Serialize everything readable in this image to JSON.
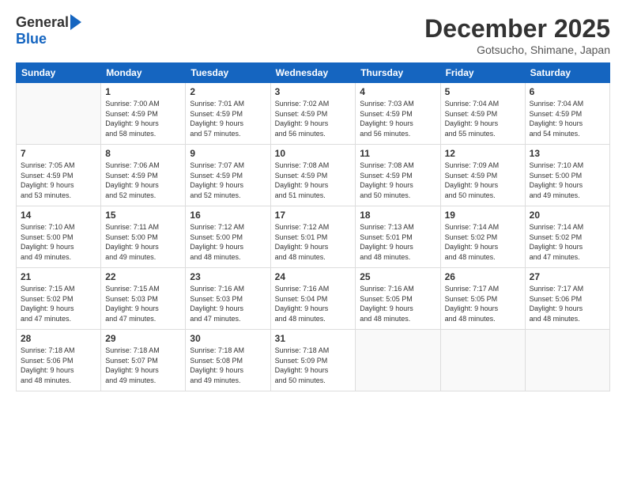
{
  "logo": {
    "general": "General",
    "blue": "Blue"
  },
  "header": {
    "month": "December 2025",
    "location": "Gotsucho, Shimane, Japan"
  },
  "weekdays": [
    "Sunday",
    "Monday",
    "Tuesday",
    "Wednesday",
    "Thursday",
    "Friday",
    "Saturday"
  ],
  "weeks": [
    [
      {
        "day": "",
        "info": ""
      },
      {
        "day": "1",
        "info": "Sunrise: 7:00 AM\nSunset: 4:59 PM\nDaylight: 9 hours\nand 58 minutes."
      },
      {
        "day": "2",
        "info": "Sunrise: 7:01 AM\nSunset: 4:59 PM\nDaylight: 9 hours\nand 57 minutes."
      },
      {
        "day": "3",
        "info": "Sunrise: 7:02 AM\nSunset: 4:59 PM\nDaylight: 9 hours\nand 56 minutes."
      },
      {
        "day": "4",
        "info": "Sunrise: 7:03 AM\nSunset: 4:59 PM\nDaylight: 9 hours\nand 56 minutes."
      },
      {
        "day": "5",
        "info": "Sunrise: 7:04 AM\nSunset: 4:59 PM\nDaylight: 9 hours\nand 55 minutes."
      },
      {
        "day": "6",
        "info": "Sunrise: 7:04 AM\nSunset: 4:59 PM\nDaylight: 9 hours\nand 54 minutes."
      }
    ],
    [
      {
        "day": "7",
        "info": ""
      },
      {
        "day": "8",
        "info": "Sunrise: 7:06 AM\nSunset: 4:59 PM\nDaylight: 9 hours\nand 52 minutes."
      },
      {
        "day": "9",
        "info": "Sunrise: 7:07 AM\nSunset: 4:59 PM\nDaylight: 9 hours\nand 52 minutes."
      },
      {
        "day": "10",
        "info": "Sunrise: 7:08 AM\nSunset: 4:59 PM\nDaylight: 9 hours\nand 51 minutes."
      },
      {
        "day": "11",
        "info": "Sunrise: 7:08 AM\nSunset: 4:59 PM\nDaylight: 9 hours\nand 50 minutes."
      },
      {
        "day": "12",
        "info": "Sunrise: 7:09 AM\nSunset: 4:59 PM\nDaylight: 9 hours\nand 50 minutes."
      },
      {
        "day": "13",
        "info": "Sunrise: 7:10 AM\nSunset: 5:00 PM\nDaylight: 9 hours\nand 49 minutes."
      }
    ],
    [
      {
        "day": "14",
        "info": "Sunrise: 7:10 AM\nSunset: 5:00 PM\nDaylight: 9 hours\nand 49 minutes."
      },
      {
        "day": "15",
        "info": "Sunrise: 7:11 AM\nSunset: 5:00 PM\nDaylight: 9 hours\nand 49 minutes."
      },
      {
        "day": "16",
        "info": "Sunrise: 7:12 AM\nSunset: 5:00 PM\nDaylight: 9 hours\nand 48 minutes."
      },
      {
        "day": "17",
        "info": "Sunrise: 7:12 AM\nSunset: 5:01 PM\nDaylight: 9 hours\nand 48 minutes."
      },
      {
        "day": "18",
        "info": "Sunrise: 7:13 AM\nSunset: 5:01 PM\nDaylight: 9 hours\nand 48 minutes."
      },
      {
        "day": "19",
        "info": "Sunrise: 7:14 AM\nSunset: 5:02 PM\nDaylight: 9 hours\nand 48 minutes."
      },
      {
        "day": "20",
        "info": "Sunrise: 7:14 AM\nSunset: 5:02 PM\nDaylight: 9 hours\nand 47 minutes."
      }
    ],
    [
      {
        "day": "21",
        "info": "Sunrise: 7:15 AM\nSunset: 5:02 PM\nDaylight: 9 hours\nand 47 minutes."
      },
      {
        "day": "22",
        "info": "Sunrise: 7:15 AM\nSunset: 5:03 PM\nDaylight: 9 hours\nand 47 minutes."
      },
      {
        "day": "23",
        "info": "Sunrise: 7:16 AM\nSunset: 5:03 PM\nDaylight: 9 hours\nand 47 minutes."
      },
      {
        "day": "24",
        "info": "Sunrise: 7:16 AM\nSunset: 5:04 PM\nDaylight: 9 hours\nand 48 minutes."
      },
      {
        "day": "25",
        "info": "Sunrise: 7:16 AM\nSunset: 5:05 PM\nDaylight: 9 hours\nand 48 minutes."
      },
      {
        "day": "26",
        "info": "Sunrise: 7:17 AM\nSunset: 5:05 PM\nDaylight: 9 hours\nand 48 minutes."
      },
      {
        "day": "27",
        "info": "Sunrise: 7:17 AM\nSunset: 5:06 PM\nDaylight: 9 hours\nand 48 minutes."
      }
    ],
    [
      {
        "day": "28",
        "info": "Sunrise: 7:18 AM\nSunset: 5:06 PM\nDaylight: 9 hours\nand 48 minutes."
      },
      {
        "day": "29",
        "info": "Sunrise: 7:18 AM\nSunset: 5:07 PM\nDaylight: 9 hours\nand 49 minutes."
      },
      {
        "day": "30",
        "info": "Sunrise: 7:18 AM\nSunset: 5:08 PM\nDaylight: 9 hours\nand 49 minutes."
      },
      {
        "day": "31",
        "info": "Sunrise: 7:18 AM\nSunset: 5:09 PM\nDaylight: 9 hours\nand 50 minutes."
      },
      {
        "day": "",
        "info": ""
      },
      {
        "day": "",
        "info": ""
      },
      {
        "day": "",
        "info": ""
      }
    ]
  ],
  "week7_sunday": {
    "day": "7",
    "info": "Sunrise: 7:05 AM\nSunset: 4:59 PM\nDaylight: 9 hours\nand 53 minutes."
  }
}
